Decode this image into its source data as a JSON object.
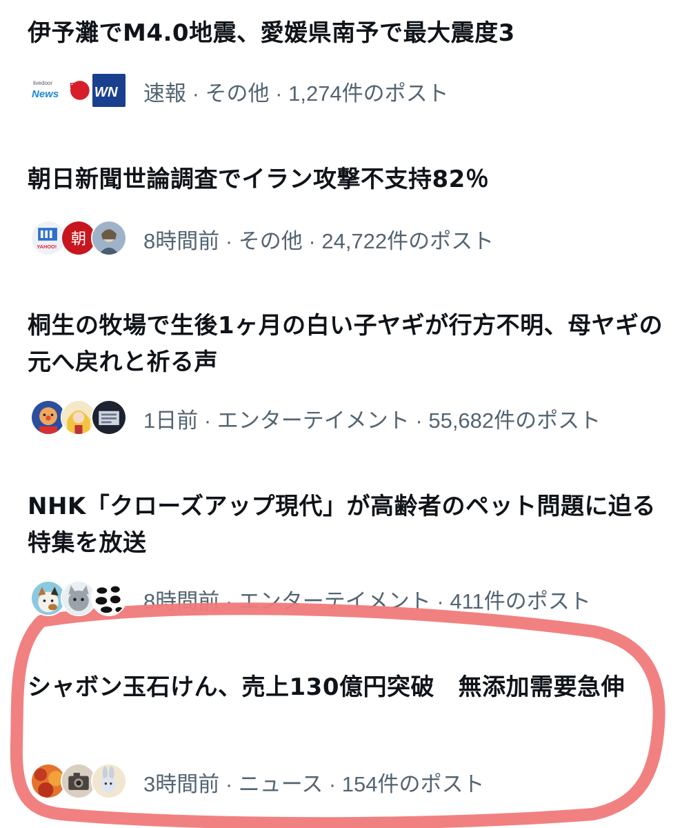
{
  "trends": [
    {
      "title": "伊予灘でM4.0地震、愛媛県南予で最大震度3",
      "meta": "速報 · その他 · 1,274件のポスト",
      "avatars": [
        "livedoor-news-logo",
        "ery-logo",
        "wnn-logo"
      ]
    },
    {
      "title": "朝日新聞世論調査でイラン攻撃不支持82％",
      "meta": "8時間前 · その他 · 24,722件のポスト",
      "avatars": [
        "yahoo-news-logo",
        "asahi-logo",
        "anime-character-avatar"
      ],
      "asahi_char": "朝"
    },
    {
      "title": "桐生の牧場で生後1ヶ月の白い子ヤギが行方不明、母ヤギの元へ戻れと祈る声",
      "meta": "1日前 · エンターテイメント · 55,682件のポスト",
      "avatars": [
        "anpanman-avatar",
        "anime-girl-avatar",
        "dark-illustration-avatar"
      ]
    },
    {
      "title": "NHK「クローズアップ現代」が高齢者のペット問題に迫る特集を放送",
      "meta": "8時間前 · エンターテイメント · 411件のポスト",
      "avatars": [
        "calico-cat-avatar",
        "grey-cat-avatar",
        "animal-silhouettes-avatar"
      ]
    },
    {
      "title": "シャボン玉石けん、売上130億円突破　無添加需要急伸",
      "meta": "3時間前 · ニュース · 154件のポスト",
      "avatars": [
        "autumn-leaves-avatar",
        "camera-avatar",
        "rabbit-avatar"
      ]
    }
  ],
  "colors": {
    "title": "#0f1419",
    "meta": "#536471",
    "highlight_circle": "#f07a7a"
  }
}
